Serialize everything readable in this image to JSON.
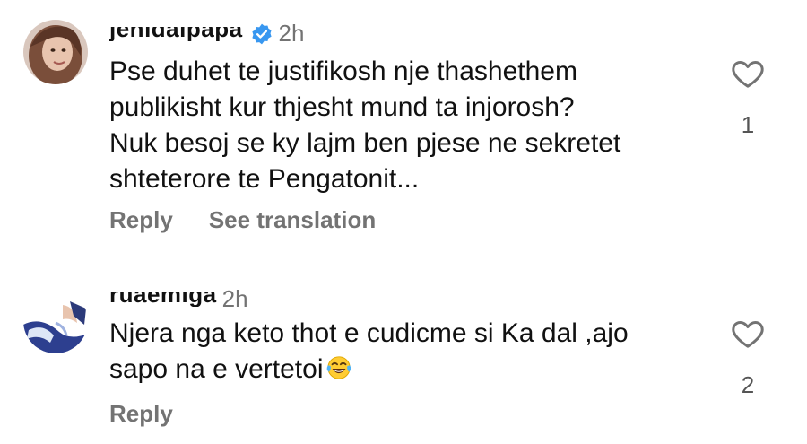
{
  "comments": [
    {
      "username": "jehidalpapa",
      "time": "2h",
      "verified": true,
      "text_lines": [
        "Pse duhet te justifikosh nje thashethem",
        "publikisht kur thjesht mund ta injorosh?",
        "Nuk besoj se ky lajm ben pjese ne sekretet",
        "shteterore te Pengatonit..."
      ],
      "like_count": "1",
      "reply_label": "Reply",
      "translation_label": "See translation"
    },
    {
      "username": "ruaemiga",
      "time": "2h",
      "text_lines": [
        "Njera nga keto thot e cudicme si Ka dal ,ajo",
        "sapo na e vertetoi"
      ],
      "emoji": "face-with-tears-of-joy",
      "like_count": "2",
      "reply_label": "Reply"
    }
  ],
  "colors": {
    "text": "#111111",
    "secondary": "#737373",
    "verified": "#3897f0"
  }
}
